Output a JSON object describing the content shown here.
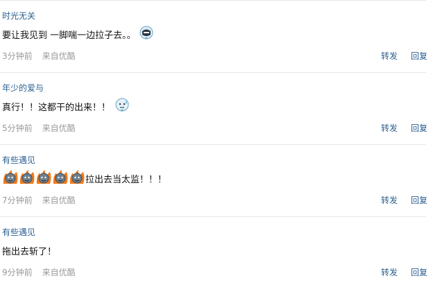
{
  "comments": [
    {
      "username": "时光无关",
      "text_before": "要让我见到 一脚喘一边拉子去。。",
      "text_after": "",
      "emoji": [
        "emoji-ninja"
      ],
      "time": "3分钟前",
      "source": "来自优酷",
      "forward_label": "转发",
      "reply_label": "回复"
    },
    {
      "username": "年少的爱与",
      "text_before": "真行！！这都干的出来！！",
      "text_after": "",
      "emoji": [
        "emoji-sweat"
      ],
      "time": "5分钟前",
      "source": "来自优酷",
      "forward_label": "转发",
      "reply_label": "回复"
    },
    {
      "username": "有些遇见",
      "text_before": "",
      "text_after": "拉出去当太监！！！",
      "emoji": [
        "emoji-fire-face",
        "emoji-fire-face",
        "emoji-fire-face",
        "emoji-fire-face",
        "emoji-fire-face"
      ],
      "time": "7分钟前",
      "source": "来自优酷",
      "forward_label": "转发",
      "reply_label": "回复"
    },
    {
      "username": "有些遇见",
      "text_before": "拖出去斩了！",
      "text_after": "",
      "emoji": [],
      "time": "9分钟前",
      "source": "来自优酷",
      "forward_label": "转发",
      "reply_label": "回复"
    }
  ],
  "colors": {
    "username": "#2b5f90",
    "action_link": "#2b5f90",
    "meta_text": "#9a9a9a",
    "divider": "#e6e6e6"
  }
}
